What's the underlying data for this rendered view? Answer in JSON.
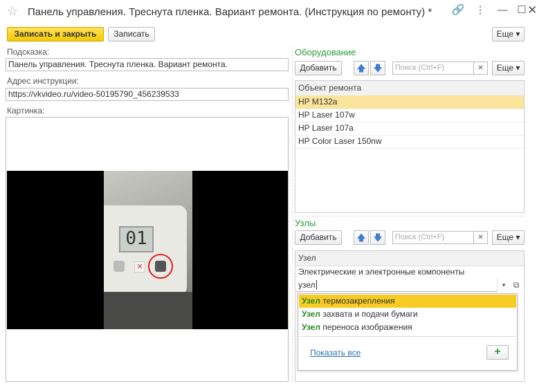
{
  "window": {
    "title": "Панель управления. Треснута пленка. Вариант ремонта. (Инструкция по ремонту) *"
  },
  "toolbar": {
    "save_close": "Записать и закрыть",
    "save": "Записать",
    "more": "Еще"
  },
  "form": {
    "hint_label": "Подсказка:",
    "hint_value": "Панель управления. Треснута пленка. Вариант ремонта.",
    "url_label": "Адрес инструкции:",
    "url_value": "https://vkvideo.ru/video-50195790_456239533",
    "picture_label": "Картинка:",
    "display_digits": "01"
  },
  "equipment": {
    "title": "Оборудование",
    "add": "Добавить",
    "search_placeholder": "Поиск (Ctrl+F)",
    "more": "Еще",
    "column": "Объект ремонта",
    "rows": [
      "HP M132a",
      "HP Laser 107w",
      "HP Laser 107a",
      "HP Color Laser 150nw"
    ]
  },
  "nodes": {
    "title": "Узлы",
    "add": "Добавить",
    "search_placeholder": "Поиск (Ctrl+F)",
    "more": "Еще",
    "column": "Узел",
    "row1": "Электрические и электронные компоненты",
    "input_value": "узел",
    "suggestions": [
      {
        "match": "Узел",
        "rest": " термозакрепления"
      },
      {
        "match": "Узел",
        "rest": " захвата и подачи бумаги"
      },
      {
        "match": "Узел",
        "rest": " переноса изображения"
      }
    ],
    "show_all": "Показать все"
  },
  "colors": {
    "accent_green": "#2a9d3a",
    "primary_yellow": "#f5c800",
    "selection": "#fbe49b"
  }
}
